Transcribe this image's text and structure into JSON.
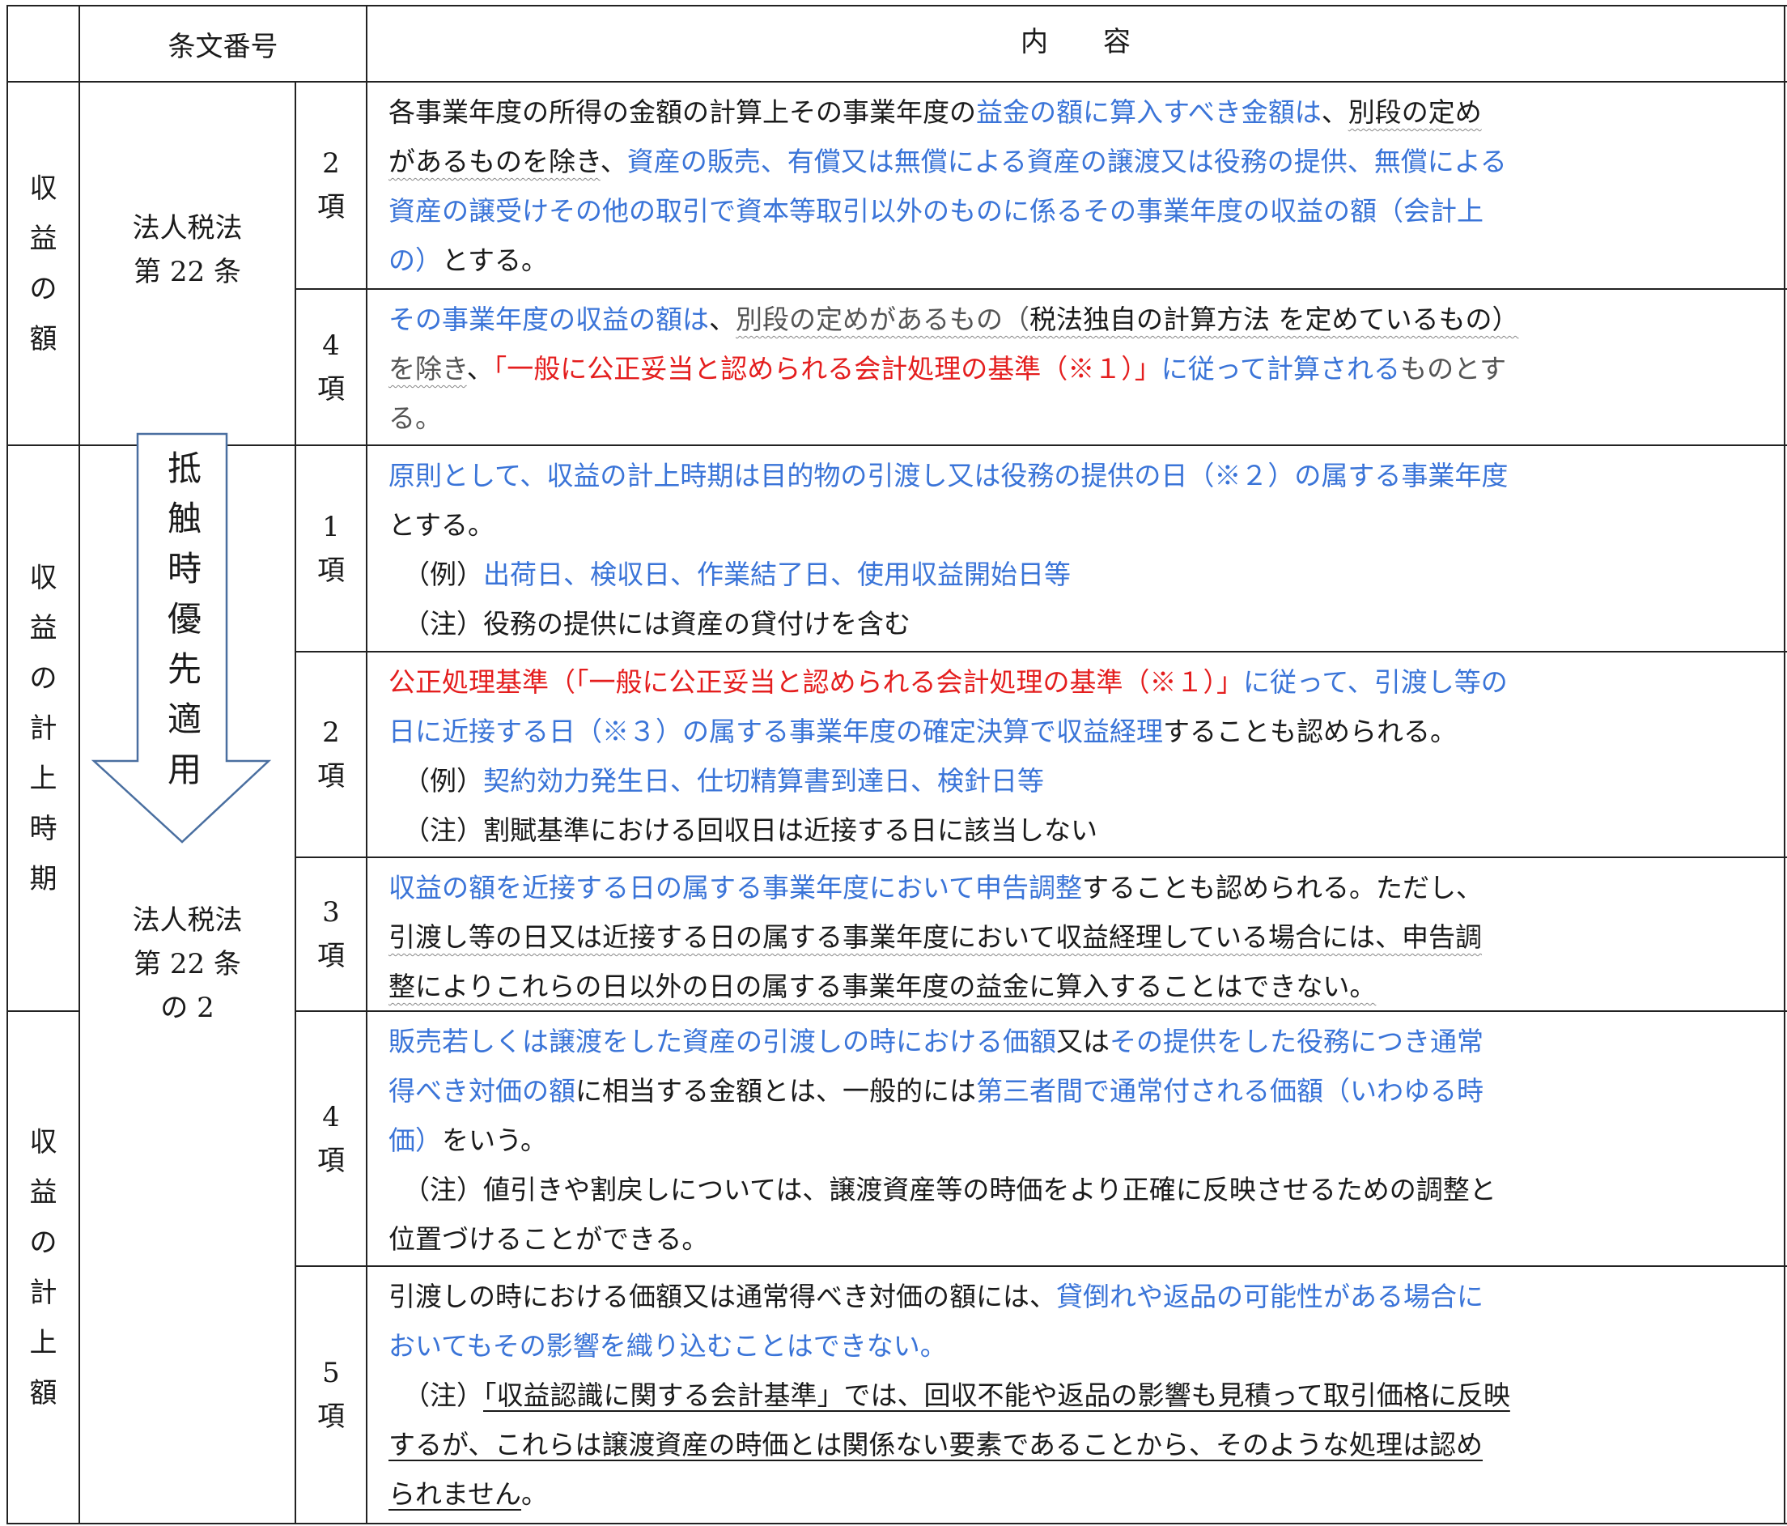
{
  "header": {
    "article_no": "条文番号",
    "content": "内　　容"
  },
  "groups": [
    {
      "label": [
        "収",
        "益",
        "の",
        "額"
      ]
    },
    {
      "label": [
        "収",
        "益",
        "の",
        "計",
        "上",
        "時",
        "期"
      ]
    },
    {
      "label": [
        "収",
        "益",
        "の",
        "計",
        "上",
        "額"
      ]
    }
  ],
  "articles": {
    "a22": [
      "法人税法",
      "第 22 条"
    ],
    "a22_2": [
      "法人税法",
      "第 22 条",
      "の 2"
    ]
  },
  "arrow_text": [
    "抵",
    "触",
    "時",
    "優",
    "先",
    "適",
    "用"
  ],
  "rows": [
    {
      "kou": [
        "2",
        "項"
      ],
      "lines": [
        [
          {
            "t": "各事業年度の所得の金額の計算上その事業年度の",
            "c": ""
          },
          {
            "t": "益金の額に算入すべき金額は",
            "c": "blue"
          },
          {
            "t": "、",
            "c": ""
          },
          {
            "t": "別段の定め",
            "c": "wav"
          }
        ],
        [
          {
            "t": "があるものを除き",
            "c": "wav"
          },
          {
            "t": "、",
            "c": ""
          },
          {
            "t": "資産の販売、有償又は無償による資産の譲渡又は役務の提供、無償による",
            "c": "blue"
          }
        ],
        [
          {
            "t": "資産の譲受けその他の取引で資本等取引以外のものに係るその事業年度の収益の額（会計上",
            "c": "blue"
          }
        ],
        [
          {
            "t": "の）",
            "c": "blue"
          },
          {
            "t": "とする。",
            "c": ""
          }
        ]
      ]
    },
    {
      "kou": [
        "4",
        "項"
      ],
      "lines": [
        [
          {
            "t": "その事業年度の収益の額は",
            "c": "blue"
          },
          {
            "t": "、",
            "c": ""
          },
          {
            "t": "別段の定めがあるもの（",
            "c": "gray wav"
          },
          {
            "t": "税法独自の計算方法 を定めているもの）",
            "c": "wav"
          }
        ],
        [
          {
            "t": "を除き",
            "c": "gray wav"
          },
          {
            "t": "、",
            "c": ""
          },
          {
            "t": "「一般に公正妥当と認められる会計処理の基準（※１）」",
            "c": "red"
          },
          {
            "t": "に従って計算される",
            "c": "blue"
          },
          {
            "t": "ものとす",
            "c": "gray"
          }
        ],
        [
          {
            "t": "る。",
            "c": "gray"
          }
        ]
      ]
    },
    {
      "kou": [
        "1",
        "項"
      ],
      "lines": [
        [
          {
            "t": "原則として、収益の計上時期は目的物の引渡し又は役務の提供の日（※２）の属する事業年度",
            "c": "blue"
          }
        ],
        [
          {
            "t": "とする。",
            "c": ""
          }
        ],
        [
          {
            "t": "（例）",
            "c": "ind"
          },
          {
            "t": "出荷日、検収日、作業結了日、使用収益開始日等",
            "c": "blue"
          }
        ],
        [
          {
            "t": "（注）役務の提供には資産の貸付けを含む",
            "c": "ind"
          }
        ]
      ]
    },
    {
      "kou": [
        "2",
        "項"
      ],
      "lines": [
        [
          {
            "t": "公正処理基準（「一般に公正妥当と認められる会計処理の基準（※１）」",
            "c": "red"
          },
          {
            "t": "に従って、引渡し等の",
            "c": "blue"
          }
        ],
        [
          {
            "t": "日に近接する日（※３）の属する事業年度の確定決算で収益経理",
            "c": "blue"
          },
          {
            "t": "することも認められる。",
            "c": ""
          }
        ],
        [
          {
            "t": "（例）",
            "c": "ind"
          },
          {
            "t": "契約効力発生日、仕切精算書到達日、検針日等",
            "c": "blue"
          }
        ],
        [
          {
            "t": "（注）割賦基準における回収日は近接する日に該当しない",
            "c": "ind"
          }
        ]
      ]
    },
    {
      "kou": [
        "3",
        "項"
      ],
      "lines": [
        [
          {
            "t": "収益の額を近接する日の属する事業年度において申告調整",
            "c": "blue"
          },
          {
            "t": "することも認められる。ただし、",
            "c": ""
          }
        ],
        [
          {
            "t": "引渡し等の日又は近接する日の属する事業年度において収益経理している場合には、申告調",
            "c": "wav"
          }
        ],
        [
          {
            "t": "整によりこれらの日以外の日の属する事業年度の益金に算入することはできない。",
            "c": "wav"
          }
        ]
      ]
    },
    {
      "kou": [
        "4",
        "項"
      ],
      "lines": [
        [
          {
            "t": "販売若しくは譲渡をした資産の引渡しの時における価額",
            "c": "blue"
          },
          {
            "t": "又は",
            "c": ""
          },
          {
            "t": "その提供をした役務につき通常",
            "c": "blue"
          }
        ],
        [
          {
            "t": "得べき対価の額",
            "c": "blue"
          },
          {
            "t": "に相当する金額とは、一般的には",
            "c": ""
          },
          {
            "t": "第三者間で通常付される価額（いわゆる時",
            "c": "blue"
          }
        ],
        [
          {
            "t": "価）",
            "c": "blue"
          },
          {
            "t": "をいう。",
            "c": ""
          }
        ],
        [
          {
            "t": "（注）値引きや割戻しについては、譲渡資産等の時価をより正確に反映させるための調整と",
            "c": "ind"
          }
        ],
        [
          {
            "t": "位置づけることができる。",
            "c": ""
          }
        ]
      ]
    },
    {
      "kou": [
        "5",
        "項"
      ],
      "lines": [
        [
          {
            "t": "引渡しの時における価額又は通常得べき対価の額には、",
            "c": ""
          },
          {
            "t": "貸倒れや返品の可能性がある場合に",
            "c": "blue"
          }
        ],
        [
          {
            "t": "おいてもその影響を織り込むことはできない。",
            "c": "blue"
          }
        ],
        [
          {
            "t": "（注）",
            "c": "ind"
          },
          {
            "t": "「収益認識に関する会計基準」では、回収不能や返品の影響も見積って取引価格に反映",
            "c": "ul"
          }
        ],
        [
          {
            "t": "するが、これらは譲渡資産の時価とは関係ない要素であることから、そのような処理は認め",
            "c": "ul"
          }
        ],
        [
          {
            "t": "られません",
            "c": "ul"
          },
          {
            "t": "。",
            "c": ""
          }
        ]
      ]
    }
  ]
}
